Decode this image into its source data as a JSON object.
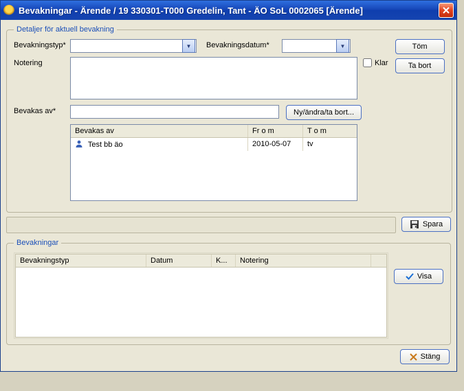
{
  "window": {
    "title": "Bevakningar - Ärende /  19 330301-T000   Gredelin, Tant   -   ÄO SoL   0002065  [Ärende]"
  },
  "group_detail": {
    "legend": "Detaljer för aktuell bevakning",
    "type_label": "Bevakningstyp*",
    "date_label": "Bevakningsdatum*",
    "note_label": "Notering",
    "klar_label": "Klar",
    "bevakas_label": "Bevakas av*",
    "ny_andra_label": "Ny/ändra/ta bort...",
    "tom_label": "Töm",
    "tabort_label": "Ta bort",
    "list_headers": {
      "name": "Bevakas av",
      "from": "Fr o m",
      "tom": "T o m"
    },
    "list_rows": [
      {
        "name": "Test bb äo",
        "from": "2010-05-07",
        "tom": "tv"
      }
    ]
  },
  "spara_label": "Spara",
  "group_bev": {
    "legend": "Bevakningar",
    "headers": {
      "type": "Bevakningstyp",
      "date": "Datum",
      "k": "K...",
      "note": "Notering"
    },
    "visa_label": "Visa"
  },
  "stang_label": "Stäng"
}
